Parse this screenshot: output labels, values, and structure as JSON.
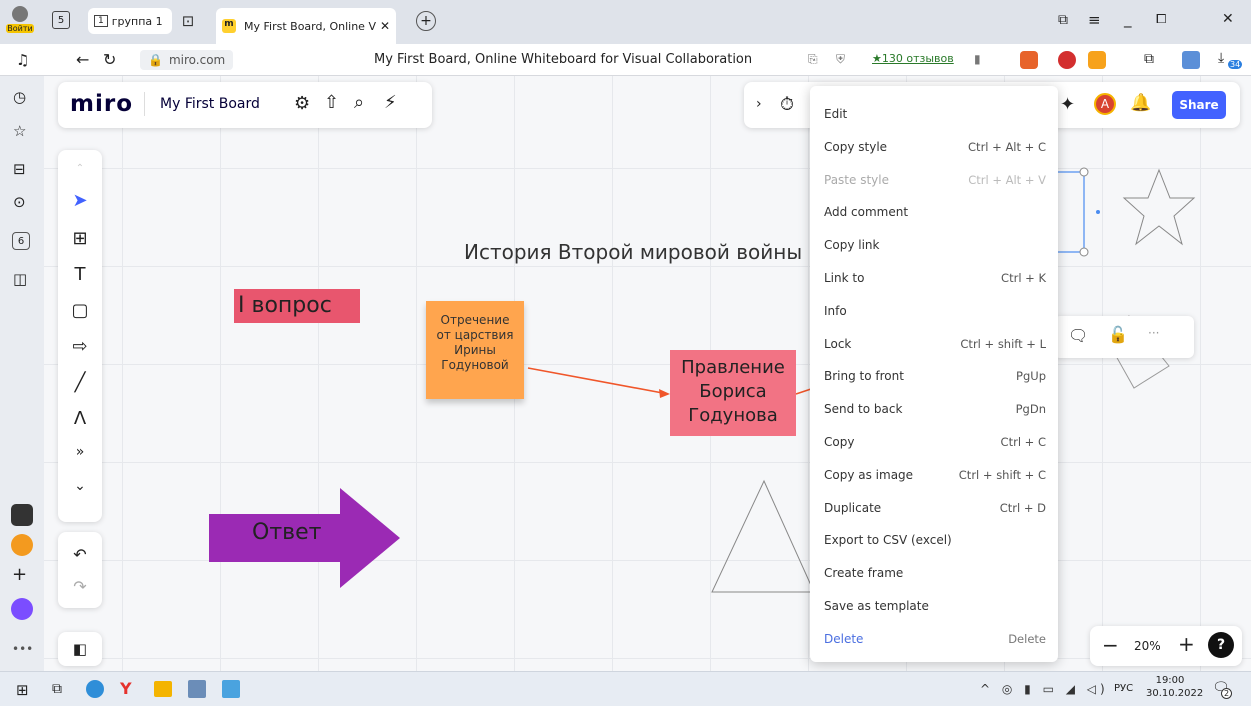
{
  "browser": {
    "login_label": "Войти",
    "tab_count": "5",
    "group_tab_label": "группа 1",
    "group_tab_num": "1",
    "active_tab_title": "My First Board, Online V",
    "address": "miro.com",
    "page_title": "My First Board, Online Whiteboard for Visual Collaboration",
    "reviews": "★130 отзывов",
    "sidebar_badge": "6",
    "download_badge": "34"
  },
  "miro": {
    "logo": "miro",
    "board_name": "My First Board",
    "share_label": "Share",
    "avatar_letter": "A",
    "zoom": "20%",
    "help": "?"
  },
  "canvas": {
    "title": "История Второй мировой войны",
    "question_label": "I вопрос",
    "sticky_text": "Отречение от царствия Ирины Годуновой",
    "card_text": "Правление Бориса Годунова",
    "arrow_label": "Ответ"
  },
  "context_menu": {
    "items": [
      {
        "label": "Edit",
        "shortcut": ""
      },
      {
        "label": "Copy style",
        "shortcut": "Ctrl + Alt + C"
      },
      {
        "label": "Paste style",
        "shortcut": "Ctrl + Alt + V"
      },
      {
        "label": "Add comment",
        "shortcut": ""
      },
      {
        "label": "Copy link",
        "shortcut": ""
      },
      {
        "label": "Link to",
        "shortcut": "Ctrl + K"
      },
      {
        "label": "Info",
        "shortcut": ""
      },
      {
        "label": "Lock",
        "shortcut": "Ctrl + shift + L"
      },
      {
        "label": "Bring to front",
        "shortcut": "PgUp"
      },
      {
        "label": "Send to back",
        "shortcut": "PgDn"
      },
      {
        "label": "Copy",
        "shortcut": "Ctrl + C"
      },
      {
        "label": "Copy as image",
        "shortcut": "Ctrl + shift + C"
      },
      {
        "label": "Duplicate",
        "shortcut": "Ctrl + D"
      },
      {
        "label": "Export to CSV (excel)",
        "shortcut": ""
      },
      {
        "label": "Create frame",
        "shortcut": ""
      },
      {
        "label": "Save as template",
        "shortcut": ""
      },
      {
        "label": "Delete",
        "shortcut": "Delete"
      }
    ]
  },
  "taskbar": {
    "time": "19:00",
    "date": "30.10.2022",
    "lang": "РУС",
    "notif": "2"
  },
  "colors": {
    "miro_blue": "#4262ff",
    "sticky_orange": "#ffa54e",
    "card_pink": "#f27384",
    "arrow_purple": "#9b2ab4",
    "question_red": "#e8566e",
    "connector": "#f0562a"
  }
}
